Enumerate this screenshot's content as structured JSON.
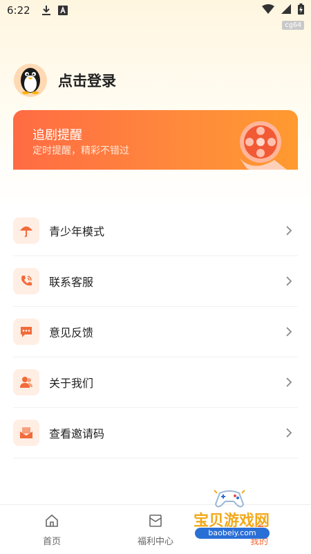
{
  "status_bar": {
    "time": "6:22",
    "tag": "cg64",
    "icons": [
      "download-icon",
      "a-badge-icon",
      "wifi-icon",
      "signal-icon",
      "battery-icon"
    ]
  },
  "profile": {
    "login_label": "点击登录",
    "avatar_icon": "penguin-icon"
  },
  "banner": {
    "title": "追剧提醒",
    "subtitle": "定时提醒，精彩不错过",
    "art_icon": "film-reel-icon"
  },
  "menu": {
    "items": [
      {
        "label": "青少年模式",
        "icon": "umbrella-icon"
      },
      {
        "label": "联系客服",
        "icon": "phone-icon"
      },
      {
        "label": "意见反馈",
        "icon": "chat-bubble-icon"
      },
      {
        "label": "关于我们",
        "icon": "users-icon"
      },
      {
        "label": "查看邀请码",
        "icon": "envelope-icon"
      }
    ]
  },
  "tabbar": {
    "tabs": [
      {
        "label": "首页",
        "icon": "home-icon"
      },
      {
        "label": "福利中心",
        "icon": "gift-icon"
      },
      {
        "label": "我的",
        "icon": "profile-icon"
      }
    ]
  },
  "watermark": {
    "text": "宝贝游戏网",
    "url": "baobeiy.com"
  },
  "colors": {
    "accent": "#ff6b43",
    "icon_bg": "#ffeee4",
    "icon_fg": "#f26b3a"
  }
}
